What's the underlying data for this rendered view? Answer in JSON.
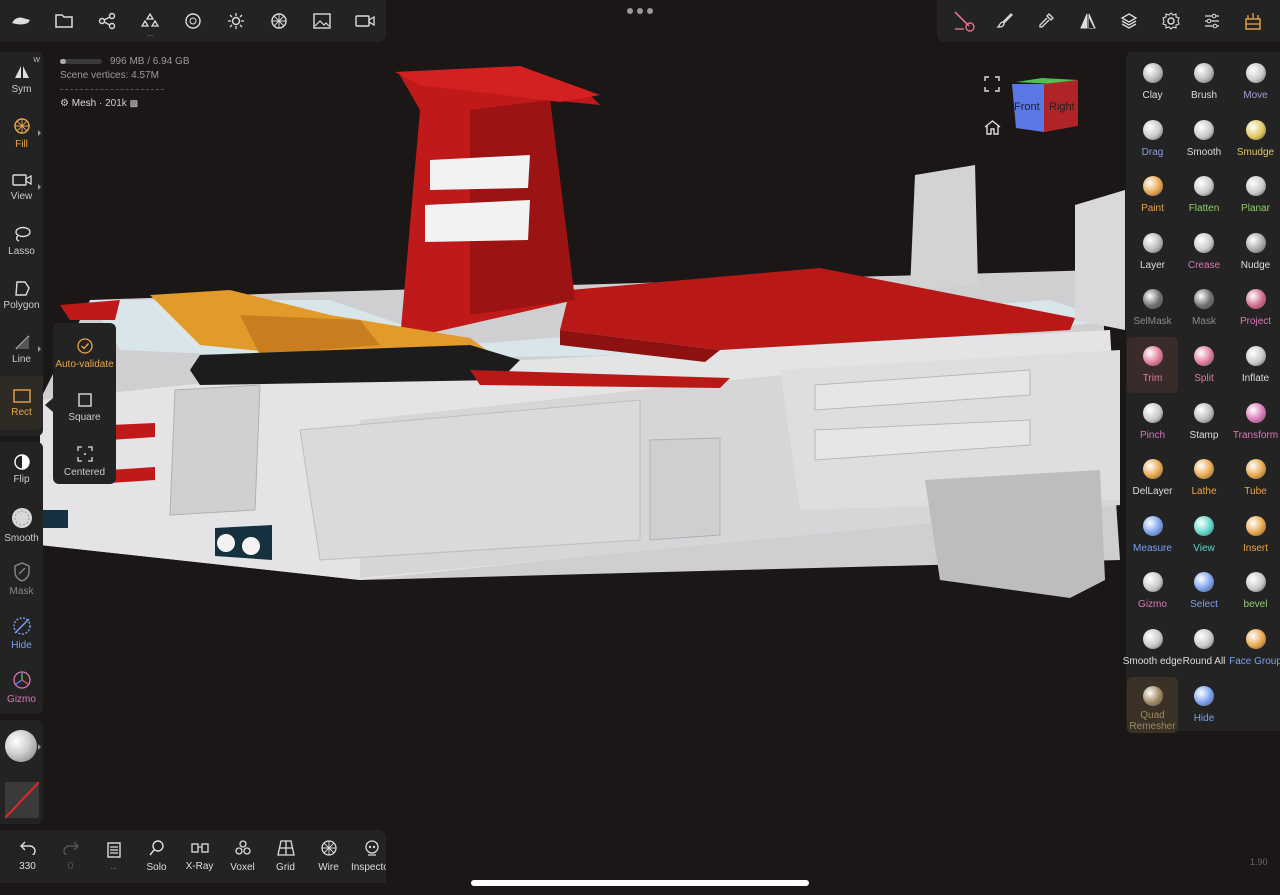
{
  "top_left_toolbar": {
    "items": [
      "app-menu-icon",
      "folder-icon",
      "share-nodes-icon",
      "scene-tree-icon",
      "materials-icon",
      "light-sun-icon",
      "post-process-icon",
      "background-image-icon",
      "camera-icon"
    ]
  },
  "top_right_toolbar": {
    "items": [
      "stroke-settings-icon",
      "brush-icon",
      "eyedropper-icon",
      "symmetry-icon",
      "layers-icon",
      "settings-gear-icon",
      "sliders-icon",
      "scene-tools-icon"
    ]
  },
  "stats": {
    "memory": "996 MB / 6.94 GB",
    "memory_fraction": 0.14,
    "vertices_label": "Scene vertices",
    "vertices": "4.57M",
    "mesh_name": "Mesh",
    "mesh_count": "201k"
  },
  "left_tools": {
    "sym": {
      "label": "Sym",
      "badge": "W"
    },
    "fill": {
      "label": "Fill"
    },
    "view": {
      "label": "View"
    },
    "lasso": {
      "label": "Lasso"
    },
    "polygon": {
      "label": "Polygon"
    },
    "line": {
      "label": "Line"
    },
    "rect": {
      "label": "Rect"
    },
    "flip": {
      "label": "Flip"
    },
    "smooth": {
      "label": "Smooth"
    },
    "mask": {
      "label": "Mask"
    },
    "hide": {
      "label": "Hide"
    },
    "gizmo": {
      "label": "Gizmo"
    }
  },
  "rect_popup": {
    "auto_validate": "Auto-validate",
    "square": "Square",
    "centered": "Centered"
  },
  "right_tools": [
    {
      "label": "Clay",
      "color": "#dddddd",
      "ball": "#b9b9b9"
    },
    {
      "label": "Brush",
      "color": "#dddddd",
      "ball": "#b9b9b9"
    },
    {
      "label": "Move",
      "color": "#a79bd6",
      "ball": "#c9c9c9"
    },
    {
      "label": "Drag",
      "color": "#8a9ee0",
      "ball": "#c9c9c9"
    },
    {
      "label": "Smooth",
      "color": "#dddddd",
      "ball": "#c9c9c9"
    },
    {
      "label": "Smudge",
      "color": "#e0c85c",
      "ball": "#e0c85c"
    },
    {
      "label": "Paint",
      "color": "#e8a64a",
      "ball": "#e8a64a"
    },
    {
      "label": "Flatten",
      "color": "#8fd06a",
      "ball": "#c9c9c9"
    },
    {
      "label": "Planar",
      "color": "#8fd06a",
      "ball": "#c9c9c9"
    },
    {
      "label": "Layer",
      "color": "#dddddd",
      "ball": "#b9b9b9"
    },
    {
      "label": "Crease",
      "color": "#d878b8",
      "ball": "#c9c9c9"
    },
    {
      "label": "Nudge",
      "color": "#dddddd",
      "ball": "#a8a8a8"
    },
    {
      "label": "SelMask",
      "color": "#8a8a8a",
      "ball": "#6e6e6e"
    },
    {
      "label": "Mask",
      "color": "#8a8a8a",
      "ball": "#6e6e6e"
    },
    {
      "label": "Project",
      "color": "#d878b8",
      "ball": "#d06a8a"
    },
    {
      "label": "Trim",
      "color": "#e07a9a",
      "ball": "#e07a9a"
    },
    {
      "label": "Split",
      "color": "#e07a9a",
      "ball": "#e07a9a"
    },
    {
      "label": "Inflate",
      "color": "#dddddd",
      "ball": "#c9c9c9"
    },
    {
      "label": "Pinch",
      "color": "#d878b8",
      "ball": "#c9c9c9"
    },
    {
      "label": "Stamp",
      "color": "#dddddd",
      "ball": "#bbbbbb"
    },
    {
      "label": "Transform",
      "color": "#d878b8",
      "ball": "#d878b8"
    },
    {
      "label": "DelLayer",
      "color": "#dddddd",
      "ball": "#e8a64a"
    },
    {
      "label": "Lathe",
      "color": "#e8a64a",
      "ball": "#e8a64a"
    },
    {
      "label": "Tube",
      "color": "#e8a64a",
      "ball": "#e8a64a"
    },
    {
      "label": "Measure",
      "color": "#7aa0f0",
      "ball": "#7aa0f0"
    },
    {
      "label": "View",
      "color": "#5fd6c8",
      "ball": "#5fd6c8"
    },
    {
      "label": "Insert",
      "color": "#e8a64a",
      "ball": "#e8a64a"
    },
    {
      "label": "Gizmo",
      "color": "#d878b8",
      "ball": "#c9c9c9"
    },
    {
      "label": "Select",
      "color": "#7aa0f0",
      "ball": "#7aa0f0"
    },
    {
      "label": "bevel",
      "color": "#8fd06a",
      "ball": "#c9c9c9"
    },
    {
      "label": "Smooth edge",
      "color": "#dddddd",
      "ball": "#c9c9c9"
    },
    {
      "label": "Round All",
      "color": "#dddddd",
      "ball": "#c9c9c9"
    },
    {
      "label": "Face Group",
      "color": "#7aa0f0",
      "ball": "#e8a64a"
    },
    {
      "label": "Quad Remesher",
      "color": "#a08660",
      "ball": "#a08660"
    },
    {
      "label": "Hide",
      "color": "#7aa0f0",
      "ball": "#7aa0f0"
    }
  ],
  "bottom_bar": {
    "undo_count": "330",
    "redo_count": "0",
    "items": [
      "Solo",
      "X-Ray",
      "Voxel",
      "Grid",
      "Wire",
      "Inspector"
    ]
  },
  "viewcube": {
    "front": "Front",
    "right": "Right"
  },
  "version": "1.90",
  "colors": {
    "panel": "#232323",
    "viewport": "#1b1716",
    "accent": "#e8a64a"
  }
}
